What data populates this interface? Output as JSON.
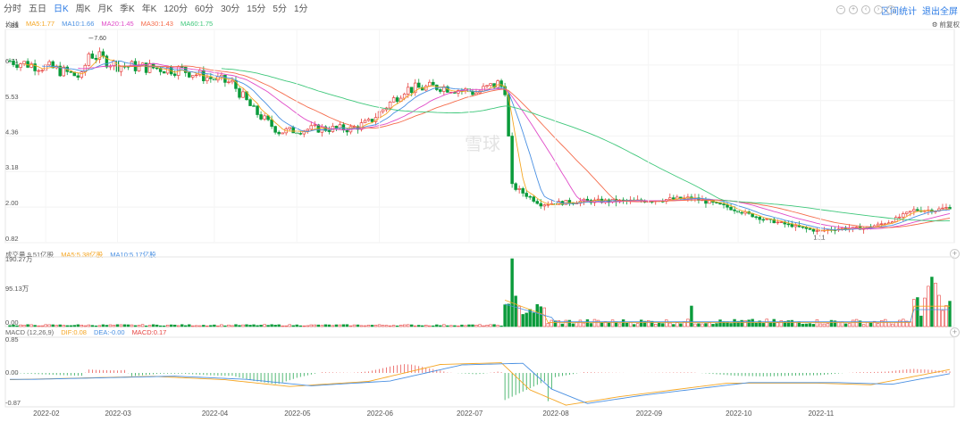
{
  "toolbar": {
    "tabs": [
      "分时",
      "五日",
      "日K",
      "周K",
      "月K",
      "季K",
      "年K",
      "120分",
      "60分",
      "30分",
      "15分",
      "5分",
      "1分"
    ],
    "active_tab": 2,
    "range_stats": "区间统计",
    "exit_fullscreen": "退出全屏"
  },
  "price_panel": {
    "legend_title": "均线",
    "ma5": "MA5:1.77",
    "ma10": "MA10:1.66",
    "ma20": "MA20:1.45",
    "ma30": "MA30:1.43",
    "ma60": "MA60:1.75",
    "adjust": "前复权",
    "y_ticks": [
      "7.89",
      "6.71",
      "5.53",
      "4.36",
      "3.18",
      "2.00",
      "0.82"
    ],
    "max_label": "7.60",
    "min_label": "1.11",
    "watermark": "雪球"
  },
  "volume_panel": {
    "legend_title": "成交量 9.51亿股",
    "ma5": "MA5:5.38亿股",
    "ma10": "MA10:5.17亿股",
    "y_ticks": [
      "190.27万",
      "95.13万",
      "0.00"
    ]
  },
  "macd_panel": {
    "legend_title": "MACD (12,26,9)",
    "dif": "DIF:0.08",
    "dea": "DEA:-0.00",
    "macd": "MACD:0.17",
    "y_ticks": [
      "0.85",
      "0.00",
      "-0.87"
    ]
  },
  "x_axis": [
    "2022-02",
    "2022-03",
    "2022-04",
    "2022-05",
    "2022-06",
    "2022-07",
    "2022-08",
    "2022-09",
    "2022-10",
    "2022-11"
  ],
  "colors": {
    "up": "#e64340",
    "down": "#0a9b3b",
    "ma5": "#f5a623",
    "ma10": "#4a90e2",
    "ma20": "#e04cc8",
    "ma30": "#f56b4b",
    "ma60": "#3ec77a",
    "accent": "#2c7be5"
  },
  "chart_data": {
    "type": "candlestick",
    "x": [
      "2022-02",
      "2022-03",
      "2022-04",
      "2022-05",
      "2022-06",
      "2022-07",
      "2022-08",
      "2022-09",
      "2022-10",
      "2022-11"
    ],
    "close_approx": [
      6.8,
      6.6,
      6.3,
      4.6,
      5.9,
      2.2,
      2.2,
      2.3,
      1.3,
      1.9
    ],
    "ylim": [
      0.82,
      7.89
    ]
  }
}
